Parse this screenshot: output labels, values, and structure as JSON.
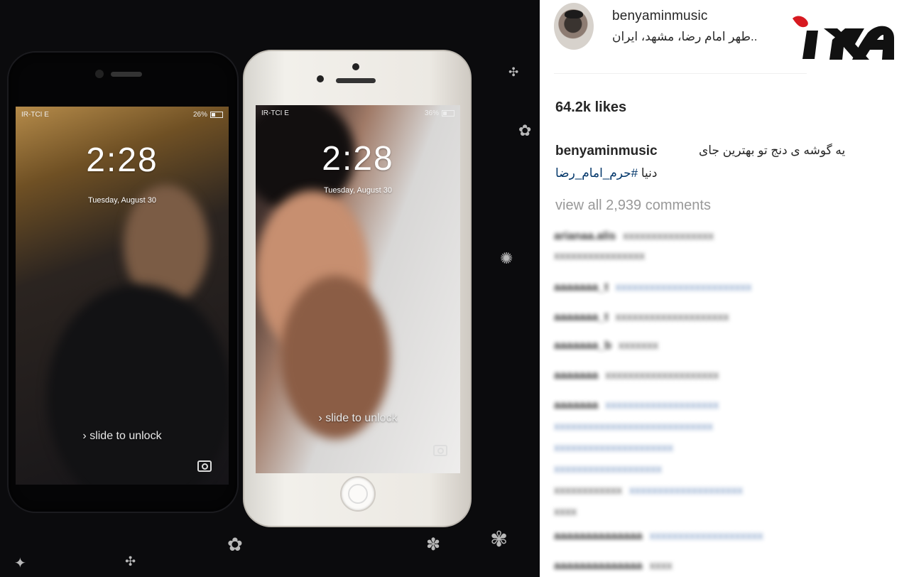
{
  "post": {
    "username": "benyaminmusic",
    "location": "..طهر امام رضا، مشهد، ایران",
    "likes": "64.2k likes",
    "caption": {
      "username": "benyaminmusic",
      "text": "یه گوشه ی دنج تو بهترین جای",
      "line2_prefix": "دنیا",
      "hashtag": "#حرم_امام_رضا"
    },
    "view_all_comments": "view all 2,939 comments"
  },
  "phones": {
    "left": {
      "carrier": "IR-TCI  E",
      "battery": "26%",
      "time": "2:28",
      "date": "Tuesday, August 30",
      "unlock": "slide to unlock"
    },
    "right": {
      "carrier": "IR-TCI  E",
      "battery": "36%",
      "time": "2:28",
      "date": "Tuesday, August 30",
      "unlock": "slide to unlock"
    }
  },
  "colors": {
    "logo_red": "#d71920",
    "logo_black": "#111111",
    "instagram_link": "#003569"
  }
}
